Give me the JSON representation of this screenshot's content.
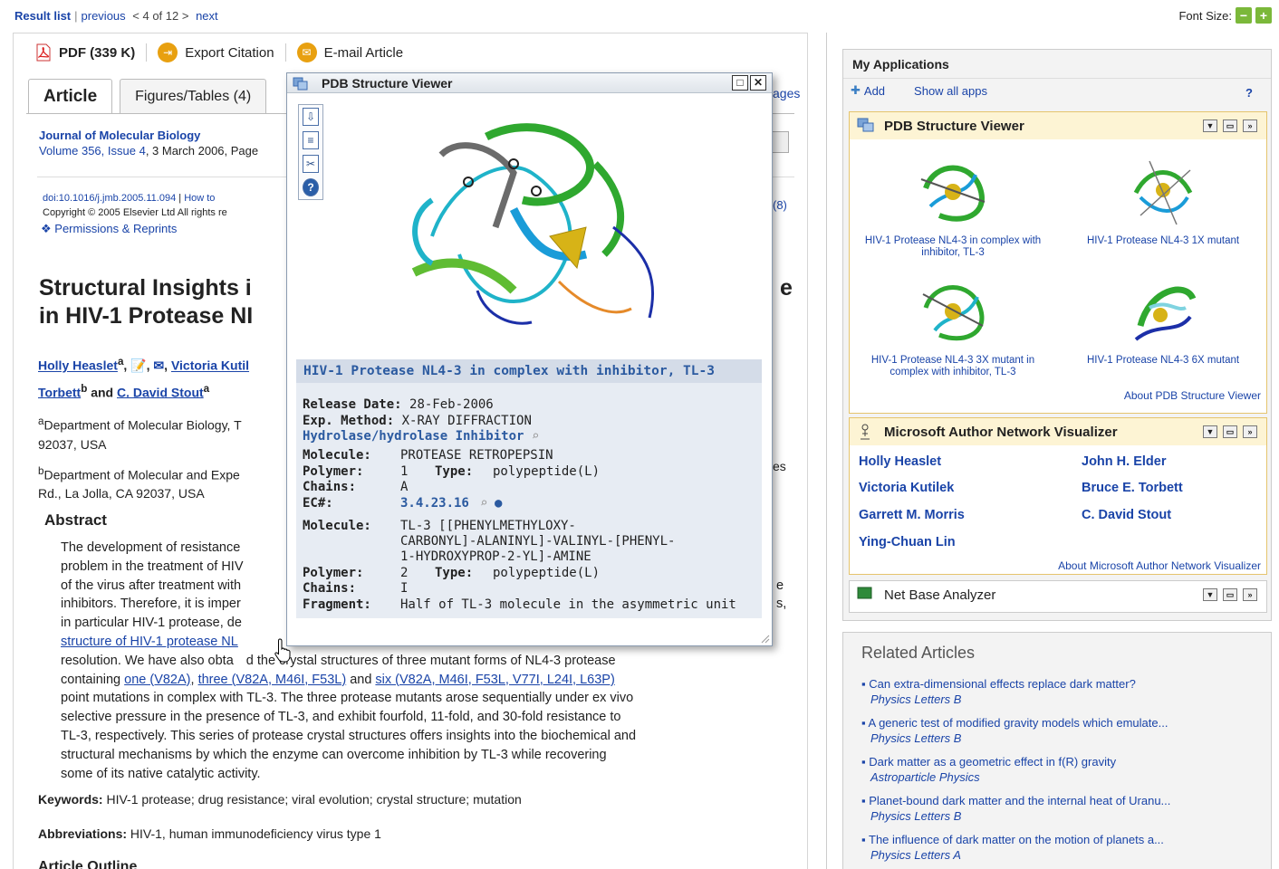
{
  "nav": {
    "result_list": "Result list",
    "previous": "previous",
    "position": "< 4 of 12 >",
    "next": "next",
    "font_size": "Font Size:",
    "font_minus": "−",
    "font_plus": "+"
  },
  "toolbar": {
    "pdf": "PDF (339 K)",
    "export": "Export Citation",
    "email": "E-mail Article"
  },
  "tabs": [
    "Article",
    "Figures/Tables (4)"
  ],
  "partial": {
    "ages": "ages",
    "eight": "(8)",
    "title_tail": "e",
    "es": "es"
  },
  "journal": {
    "name": "Journal of Molecular Biology",
    "volume": "Volume 356, Issue 4",
    "date": ", 3 March 2006, Page",
    "doi": "doi:10.1016/j.jmb.2005.11.094",
    "doi_sep": " | ",
    "howto": "How to",
    "copyright": "Copyright © 2005 Elsevier Ltd All rights re",
    "permissions": "Permissions & Reprints"
  },
  "article": {
    "title_line1": "Structural Insights i",
    "title_line2": "in HIV-1 Protease NI",
    "author1": "Holly Heaslet",
    "author1_sup": "a",
    "author2": "Victoria Kutil",
    "author3": "Torbett",
    "author3_sup": "b",
    "and": " and ",
    "author4": "C. David Stout",
    "author4_sup": "a",
    "affil_a": "Department of Molecular Biology, T",
    "affil_a2": "92037, USA",
    "affil_b": "Department of Molecular and Expe",
    "affil_b2": "Rd., La Jolla, CA 92037, USA",
    "abstract_heading": "Abstract",
    "abstract_lines": [
      "The development of resistance",
      "problem in the treatment of HIV",
      "of the virus after treatment with",
      "inhibitors. Therefore, it is imper",
      "in particular HIV-1 protease, de"
    ],
    "abstract_link_line": "structure of HIV-1 protease NL",
    "abstract_line7a": "resolution. We have also obta",
    "abstract_line7b": "d the crystal structures of three mutant forms of NL4-3 protease",
    "abstract_line8_pre": "containing ",
    "abstract_link_one": "one (V82A)",
    "abstract_link_three": "three (V82A, M46I, F53L)",
    "abstract_line8_and": " and ",
    "abstract_link_six": "six (V82A, M46I, F53L, V77I, L24I, L63P)",
    "abstract_rest": [
      "point mutations in complex with TL-3. The three protease mutants arose sequentially under ex vivo",
      "selective pressure in the presence of TL-3, and exhibit fourfold, 11-fold, and 30-fold resistance to",
      "TL-3, respectively. This series of protease crystal structures offers insights into the biochemical and",
      "structural mechanisms by which the enzyme can overcome inhibition by TL-3 while recovering",
      "some of its native catalytic activity."
    ],
    "keywords_label": "Keywords:",
    "keywords": " HIV-1 protease; drug resistance; viral evolution; crystal structure; mutation",
    "abbrev_label": "Abbreviations:",
    "abbrev": " HIV-1, human immunodeficiency virus type 1",
    "outline": "Article Outline"
  },
  "popup": {
    "title": "PDB Structure Viewer",
    "structure_title": "HIV-1 Protease NL4-3 in complex with inhibitor, TL-3",
    "release_label": "Release Date:",
    "release": "28-Feb-2006",
    "method_label": "Exp. Method:",
    "method": "X-RAY DIFFRACTION",
    "classification": "Hydrolase/hydrolase Inhibitor",
    "mol1_label": "Molecule:",
    "mol1": "PROTEASE RETROPEPSIN",
    "poly_label": "Polymer:",
    "poly1": "1",
    "type_label": "Type:",
    "type1": "polypeptide(L)",
    "chains_label": "Chains:",
    "chains1": "A",
    "ec_label": "EC#:",
    "ec": "3.4.23.16",
    "mol2_label": "Molecule:",
    "mol2_l1": "TL-3 [[PHENYLMETHYLOXY-",
    "mol2_l2": "CARBONYL]-ALANINYL]-VALINYL-[PHENYL-",
    "mol2_l3": "1-HYDROXYPROP-2-YL]-AMINE",
    "poly2": "2",
    "type2": "polypeptide(L)",
    "chains2": "I",
    "frag_label": "Fragment:",
    "frag": "Half of TL-3 molecule in the asymmetric unit"
  },
  "apps": {
    "heading": "My Applications",
    "add": "Add",
    "show_all": "Show all apps",
    "help": "?",
    "pdb_title": "PDB Structure Viewer",
    "pdb_items": [
      "HIV-1 Protease NL4-3 in complex with inhibitor, TL-3",
      "HIV-1 Protease NL4-3 1X mutant",
      "HIV-1 Protease NL4-3 3X mutant in complex with inhibitor, TL-3",
      "HIV-1 Protease NL4-3 6X mutant"
    ],
    "pdb_about": "About PDB Structure Viewer",
    "msan_title": "Microsoft Author Network Visualizer",
    "msan_authors": [
      "Holly Heaslet",
      "John H. Elder",
      "Victoria Kutilek",
      "Bruce E. Torbett",
      "Garrett M. Morris",
      "C. David Stout",
      "Ying-Chuan Lin"
    ],
    "msan_about": "About Microsoft Author Network Visualizer",
    "net_title": "Net Base Analyzer"
  },
  "related": {
    "heading": "Related Articles",
    "items": [
      {
        "title": "Can extra-dimensional effects replace dark matter?",
        "journal": "Physics Letters B"
      },
      {
        "title": "A generic test of modified gravity models which emulate...",
        "journal": "Physics Letters B"
      },
      {
        "title": "Dark matter as a geometric effect in f(R) gravity",
        "journal": "Astroparticle Physics"
      },
      {
        "title": "Planet-bound dark matter and the internal heat of Uranu...",
        "journal": "Physics Letters B"
      },
      {
        "title": "The influence of dark matter on the motion of planets a...",
        "journal": "Physics Letters A"
      }
    ]
  }
}
